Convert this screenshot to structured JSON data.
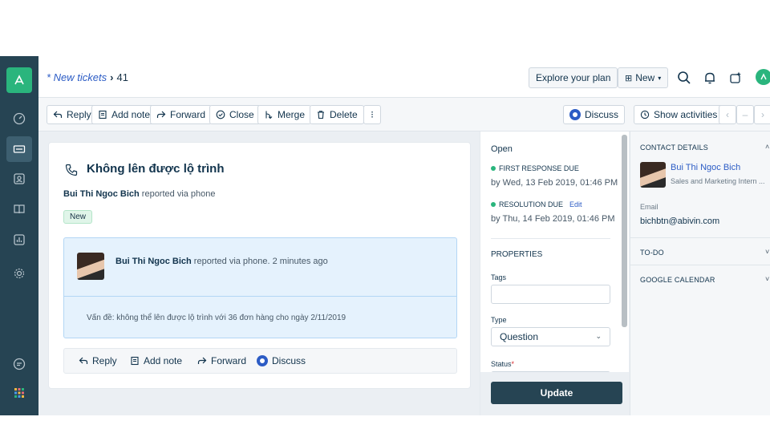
{
  "colors": {
    "nav_bg": "#264453",
    "accent": "#2c5cc5",
    "success": "#2ab57d",
    "primary_button": "#264453"
  },
  "topbar": {
    "breadcrumb_link": "* New tickets",
    "breadcrumb_sep": "›",
    "ticket_number": "41",
    "explore_plan": "Explore your plan",
    "new_label": "New",
    "icons": [
      "search-icon",
      "bell-icon",
      "sparkle-icon",
      "user-avatar"
    ]
  },
  "nav": {
    "icons": [
      "logo-icon",
      "dashboard-icon",
      "tickets-icon",
      "contacts-icon",
      "book-icon",
      "analytics-icon",
      "settings-icon",
      "chat-icon",
      "apps-grid-icon"
    ]
  },
  "toolbar": {
    "reply": "Reply",
    "add_note": "Add note",
    "forward": "Forward",
    "close": "Close",
    "merge": "Merge",
    "delete": "Delete",
    "more": "⁝",
    "discuss": "Discuss",
    "show_activities": "Show activities"
  },
  "ticket": {
    "title": "Không lên được lộ trình",
    "reporter_name": "Bui Thi Ngoc Bich",
    "reporter_suffix": " reported via phone",
    "status": "New",
    "message": {
      "author": "Bui Thi Ngoc Bich",
      "meta_suffix": " reported via phone. 2 minutes ago",
      "body": "Vấn đề: không thể lên được lộ trình với 36 đơn hàng cho ngày 2/11/2019"
    },
    "reply_bar": {
      "reply": "Reply",
      "add_note": "Add note",
      "forward": "Forward",
      "discuss": "Discuss"
    }
  },
  "properties": {
    "state": "Open",
    "first_response_label": "FIRST RESPONSE DUE",
    "first_response_value": "by Wed, 13 Feb 2019, 01:46 PM",
    "resolution_label": "RESOLUTION DUE",
    "resolution_edit": "Edit",
    "resolution_value": "by Thu, 14 Feb 2019, 01:46 PM",
    "heading": "PROPERTIES",
    "tags_label": "Tags",
    "tags_value": "",
    "type_label": "Type",
    "type_value": "Question",
    "status_label": "Status",
    "required_mark": "*",
    "update_button": "Update"
  },
  "sidebar": {
    "contact_heading": "CONTACT DETAILS",
    "contact_name": "Bui Thi Ngoc Bich",
    "contact_role": "Sales and Marketing Intern ...",
    "email_label": "Email",
    "email_value": "bichbtn@abivin.com",
    "todo_heading": "TO-DO",
    "calendar_heading": "GOOGLE CALENDAR"
  }
}
